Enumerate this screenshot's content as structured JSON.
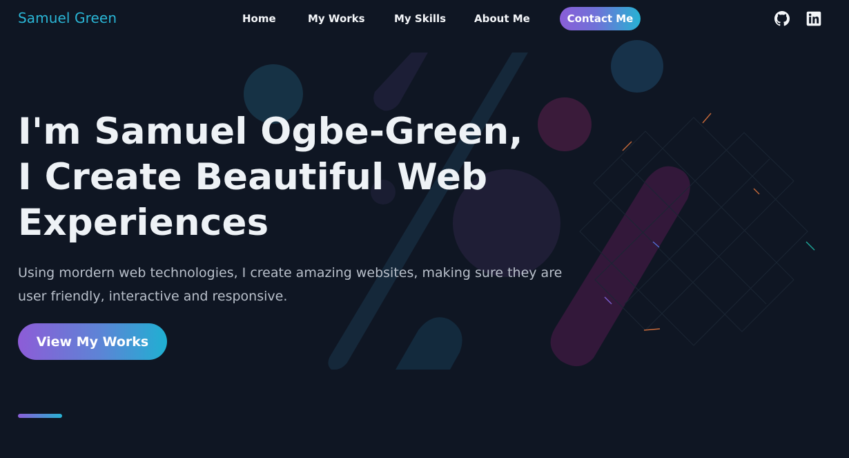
{
  "nav": {
    "brand": "Samuel Green",
    "links": [
      {
        "label": "Home"
      },
      {
        "label": "My Works"
      },
      {
        "label": "My Skills"
      },
      {
        "label": "About Me"
      }
    ],
    "contact_label": "Contact Me",
    "social_icons": [
      "github-icon",
      "linkedin-icon"
    ]
  },
  "hero": {
    "title_lines": [
      "I'm Samuel Ogbe-Green,",
      "I Create Beautiful Web",
      "Experiences"
    ],
    "subtitle": "Using mordern web technologies, I create amazing websites, making sure they are user friendly, interactive and responsive.",
    "cta_label": "View My Works"
  },
  "colors": {
    "background": "#0f1623",
    "accent_cyan": "#2ab6d6",
    "accent_purple": "#8a5ed8",
    "text": "#eef2f6",
    "subtext": "#b9c0cb"
  }
}
